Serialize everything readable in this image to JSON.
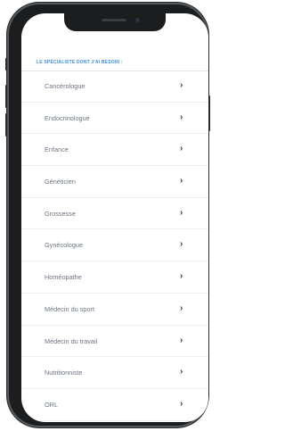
{
  "header": {
    "title": "LE SPÉCIALISTE DONT J'AI BESOIN :"
  },
  "specialists": [
    {
      "label": "Cancérologue",
      "chevron": "›"
    },
    {
      "label": "Endocrinologue",
      "chevron": "›"
    },
    {
      "label": "Enfance",
      "chevron": "›"
    },
    {
      "label": "Généticien",
      "chevron": "›"
    },
    {
      "label": "Grossesse",
      "chevron": "›"
    },
    {
      "label": "Gynécologue",
      "chevron": "›"
    },
    {
      "label": "Homéopathe",
      "chevron": "›"
    },
    {
      "label": "Médecin du sport",
      "chevron": "›"
    },
    {
      "label": "Médecin du travail",
      "chevron": "›"
    },
    {
      "label": "Nutritionniste",
      "chevron": "›"
    },
    {
      "label": "ORL",
      "chevron": "›"
    }
  ],
  "colors": {
    "accent": "#3d8fd6",
    "item_text": "#6c7480",
    "chevron": "#3c4048",
    "divider": "#eceff3",
    "phone_frame": "#1c1d1f"
  },
  "icons": {
    "chevron": "chevron-right-icon"
  }
}
